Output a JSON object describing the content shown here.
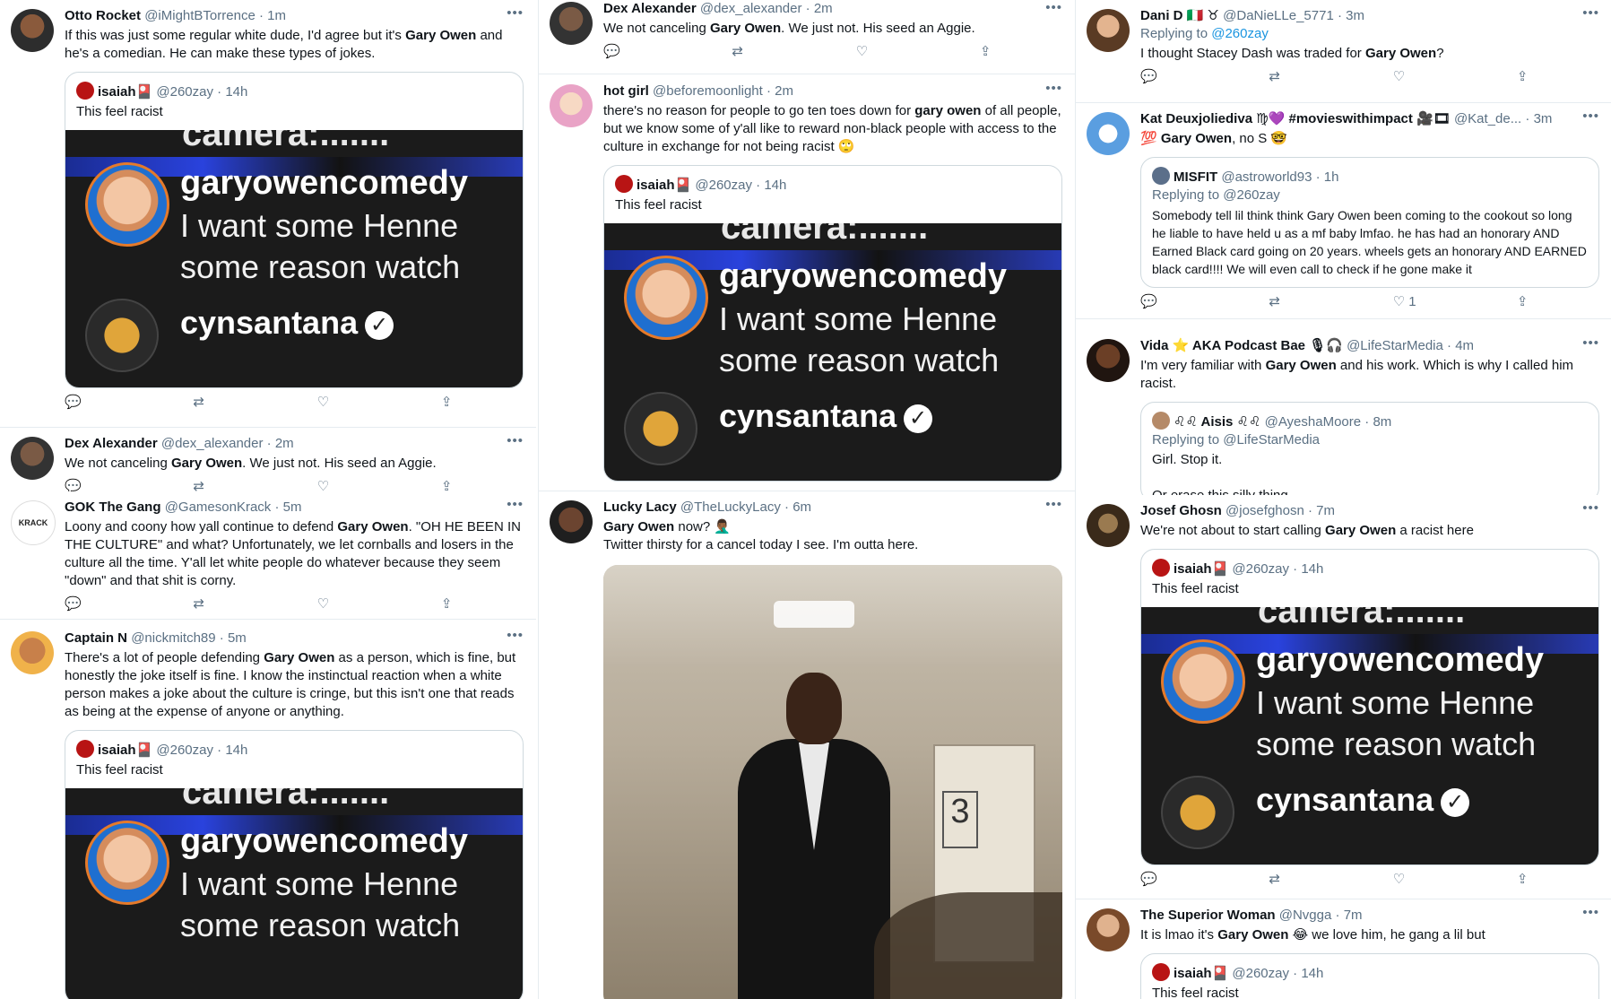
{
  "icons": {
    "more": "more-icon",
    "reply": "reply-icon",
    "retweet": "retweet-icon",
    "like": "like-icon",
    "share": "share-icon"
  },
  "quoted_isaiah": {
    "name": "isaiah🎴",
    "handle": "@260zay",
    "time": "14h",
    "text": "This feel racist",
    "media": {
      "top_fragment": "camera:.......",
      "line1": "garyowencomedy",
      "line2": "I want some Henne",
      "line3": "some reason watch",
      "line4": "cynsantana"
    }
  },
  "col1": [
    {
      "name": "Otto Rocket",
      "handle": "@iMightBTorrence",
      "time": "1m",
      "text_pre": "If this was just some regular white dude, I'd agree but it's ",
      "bold": "Gary Owen",
      "text_post": " and he's a comedian. He can make these types of jokes."
    },
    {
      "name": "Dex Alexander",
      "handle": "@dex_alexander",
      "time": "2m",
      "text_pre": "We not canceling ",
      "bold": "Gary Owen",
      "text_post": ". We just not. His seed an Aggie."
    },
    {
      "name": "GOK The Gang",
      "handle": "@GamesonKrack",
      "time": "5m",
      "text_pre": "Loony and coony how yall continue to defend ",
      "bold": "Gary Owen",
      "text_post": ". \"OH HE BEEN IN THE CULTURE\" and what? Unfortunately, we let cornballs and losers in the culture all the time. Y'all let white people do whatever because they seem \"down\" and that shit is corny."
    },
    {
      "name": "Captain N",
      "handle": "@nickmitch89",
      "time": "5m",
      "text_pre": "There's a lot of people defending ",
      "bold": "Gary Owen",
      "text_post": " as a person, which is fine, but honestly the joke itself is fine. I know the instinctual reaction when a white person makes a joke about the culture is cringe, but this isn't one that reads as being at the expense of anyone or anything."
    }
  ],
  "col2": [
    {
      "name": "Dex Alexander",
      "handle": "@dex_alexander",
      "time": "2m",
      "text_pre": "We not canceling ",
      "bold": "Gary Owen",
      "text_post": ". We just not. His seed an Aggie."
    },
    {
      "name": "hot girl",
      "handle": "@beforemoonlight",
      "time": "2m",
      "text_pre": "there's no reason for people to go ten toes down for ",
      "bold": "gary owen",
      "text_post": " of all people, but we know some of y'all like to reward non-black people with access to the culture in exchange for not being racist 🙄"
    },
    {
      "name": "Lucky Lacy",
      "handle": "@TheLuckyLacy",
      "time": "6m",
      "text_pre": "",
      "bold": "Gary Owen",
      "text_post": " now? 🤦🏾‍♂️",
      "text_line2": "Twitter thirsty for a cancel today I see. I'm outta here."
    }
  ],
  "col3": [
    {
      "name": "Dani D 🇮🇹 ♉",
      "handle": "@DaNieLLe_5771",
      "time": "3m",
      "reply_label": "Replying to ",
      "reply_handle": "@260zay",
      "text_pre": "I thought Stacey Dash was traded for ",
      "bold": "Gary Owen",
      "text_post": "?"
    },
    {
      "name": "Kat Deuxjoliediva ♍💜 #movieswithimpact 🎥🎞",
      "handle": "@Kat_de...",
      "time": "3m",
      "text_pre": "💯 ",
      "bold": "Gary Owen",
      "text_post": ", no S 🤓",
      "quote": {
        "name": "MISFIT",
        "handle": "@astroworld93",
        "time": "1h",
        "reply_label": "Replying to @260zay",
        "text": "Somebody tell lil think think Gary Owen been coming to the cookout so long he liable to have held u as a mf baby lmfao. he has had an honorary AND Earned Black card going on 20 years. wheels gets an honorary AND EARNED black card!!!!  We will even call to check if he gone make it"
      },
      "like_count": "1"
    },
    {
      "name": "Vida ⭐ AKA Podcast Bae 🎙🎧",
      "handle": "@LifeStarMedia",
      "time": "4m",
      "text_pre": "I'm very familiar with ",
      "bold": "Gary Owen",
      "text_post": " and his work. Which is why I called him racist.",
      "quote": {
        "name": "♌♌ Aisis ♌♌",
        "handle": "@AyeshaMoore",
        "time": "8m",
        "reply_label": "Replying to @LifeStarMedia",
        "text": "Girl. Stop it.",
        "text2": "Or erase this silly thing"
      }
    },
    {
      "name": "Josef Ghosn",
      "handle": "@josefghosn",
      "time": "7m",
      "text_pre": "We're not about to start calling ",
      "bold": "Gary Owen",
      "text_post": " a racist here"
    },
    {
      "name": "The Superior Woman",
      "handle": "@Nvgga",
      "time": "7m",
      "text_pre": "It is lmao it's ",
      "bold": "Gary Owen",
      "text_post": " 😂 we love him, he gang a lil but"
    }
  ]
}
